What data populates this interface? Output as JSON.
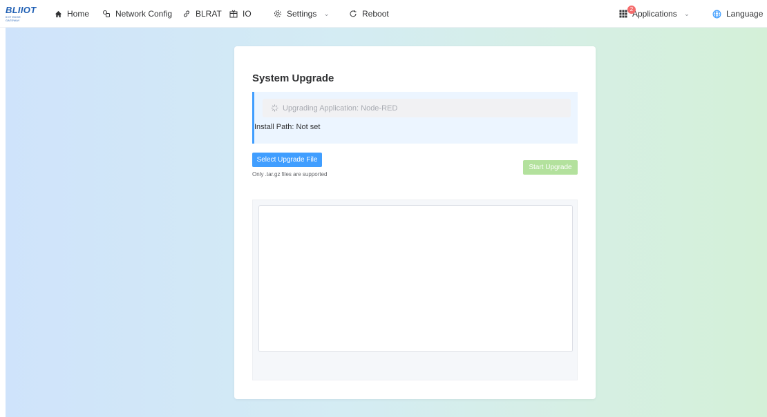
{
  "nav": {
    "logo": {
      "title": "BLIIOT",
      "subtitle": "IIOT EDGE GATEWAY"
    },
    "home": "Home",
    "network_config": "Network Config",
    "blrat": "BLRAT",
    "io": "IO",
    "settings": "Settings",
    "reboot": "Reboot",
    "applications": "Applications",
    "applications_badge": "2",
    "language": "Language"
  },
  "page": {
    "title": "System Upgrade",
    "status_text": "Upgrading Application: Node-RED",
    "install_path": "Install Path: Not set",
    "select_button": "Select Upgrade File",
    "file_hint": "Only .tar.gz files are supported",
    "start_button": "Start Upgrade",
    "log_content": ""
  },
  "colors": {
    "primary": "#409eff",
    "primary_disabled": "#b3e19d",
    "badge": "#f56c6c",
    "info_bg": "#ecf5ff"
  }
}
